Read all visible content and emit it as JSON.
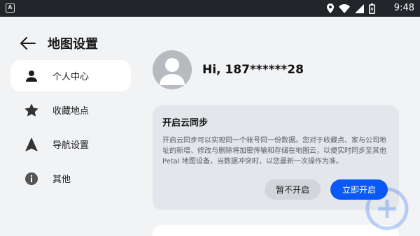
{
  "statusbar": {
    "left_badge": "A",
    "time": "9:48"
  },
  "header": {
    "title": "地图设置"
  },
  "nav": {
    "items": [
      {
        "label": "个人中心",
        "icon": "person-icon",
        "active": true
      },
      {
        "label": "收藏地点",
        "icon": "star-icon",
        "active": false
      },
      {
        "label": "导航设置",
        "icon": "navigation-arrow-icon",
        "active": false
      },
      {
        "label": "其他",
        "icon": "info-icon",
        "active": false
      }
    ]
  },
  "profile": {
    "greeting": "Hi, 187******28"
  },
  "sync_card": {
    "title": "开启云同步",
    "description": "开启云同步可以实现同一个帐号同一份数据。您对于收藏点、家与公司地址的新增、修改与删除将加密传输和存储在地图云，以便实时同步至其他 Petal 地图设备，当数据冲突时，以您最新一次操作为准。",
    "decline_label": "暂不开启",
    "accept_label": "立即开启"
  },
  "colors": {
    "accent": "#0a59f7",
    "background": "#f1f3f5",
    "card": "#e3e6ea"
  }
}
